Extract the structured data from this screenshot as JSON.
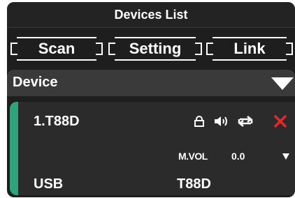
{
  "window": {
    "title": "Devices List"
  },
  "toolbar": {
    "scan_label": "Scan",
    "setting_label": "Setting",
    "link_label": "Link"
  },
  "section": {
    "title": "Device"
  },
  "device": {
    "name": "1.T88D",
    "volume_label": "M.VOL",
    "volume_value": "0.0",
    "connection": "USB",
    "model": "T88D"
  },
  "colors": {
    "accent": "#2fa37a",
    "close": "#e8262b",
    "background": "#1e1e1e",
    "card": "#2b2b2b"
  },
  "icons": [
    "lock-icon",
    "speaker-icon",
    "swap-icon",
    "close-icon"
  ]
}
